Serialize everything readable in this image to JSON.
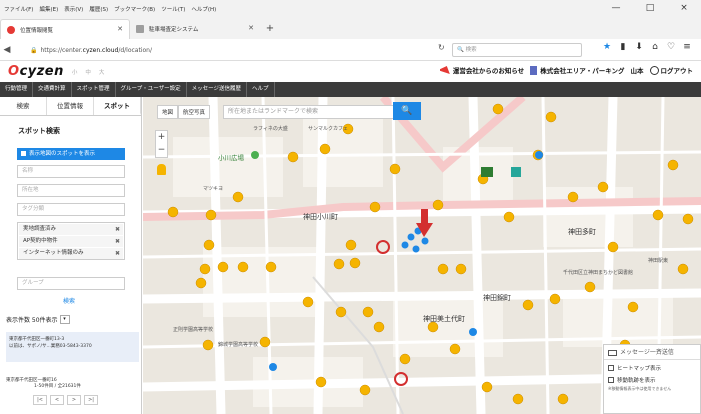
{
  "browser": {
    "menu": [
      "ファイル(F)",
      "編集(E)",
      "表示(V)",
      "履歴(S)",
      "ブックマーク(B)",
      "ツール(T)",
      "ヘルプ(H)"
    ],
    "window_controls": [
      "—",
      "□",
      "×"
    ],
    "tabs": [
      {
        "label": "位置情報閲覧",
        "active": true
      },
      {
        "label": "駐車場査定システム",
        "active": false
      }
    ],
    "new_tab": "+",
    "url_prefix": "https://center.",
    "url_host": "cyzen.cloud",
    "url_path": "/d/location/",
    "search_placeholder": "検索"
  },
  "app": {
    "logo_o": "O",
    "logo_rest": "cyzen",
    "sizes": [
      "小",
      "中",
      "大"
    ],
    "notice": "運営会社からのお知らせ",
    "company": "株式会社エリア・パーキング",
    "user": "山本",
    "logout": "ログアウト",
    "menu": [
      "行動管理",
      "交通費計算",
      "スポット管理",
      "グループ・ユーザー設定",
      "メッセージ送信履歴",
      "ヘルプ"
    ]
  },
  "panel": {
    "tabs": [
      "検索",
      "位置情報",
      "スポット"
    ],
    "title": "スポット検索",
    "show_button": "表示地図のスポットを表示",
    "name_placeholder": "名称",
    "address_placeholder": "所在地",
    "tag_placeholder": "タグ分類",
    "chips": [
      "実地調査済み",
      "AP契約中物件",
      "インターネット情報のみ"
    ],
    "group_placeholder": "グループ",
    "search_button": "検索",
    "count_label": "表示件数 50件表示",
    "result1_line1": "東京都千代田区一番町13-3",
    "result1_line2": "以前は、サポノ/サ...業務03-5843-3370",
    "result2_line1": "東京都千代田区一番町16",
    "result2_line2": "1-50件目 / 全21631件",
    "pager": [
      "|<",
      "<",
      ">",
      ">|"
    ]
  },
  "map": {
    "types": [
      "地図",
      "航空写真"
    ],
    "search_placeholder": "所在地またはランドマークで検索",
    "labels": [
      "小川広場",
      "神田小川町",
      "神田多町",
      "千代田区立神田まちかど図書館",
      "神田駅東",
      "神田美土代町",
      "神田錦町",
      "正則学園高等学校",
      "錦城学園高等学校",
      "ラフィネの大盛",
      "マツキヨ",
      "サンマルクカフェ"
    ],
    "message_box": {
      "title": "メッセージ一斉送信",
      "options": [
        "ヒートマップ表示",
        "移動軌跡を表示"
      ],
      "note": "※移動情報表示中は使用できません"
    }
  }
}
